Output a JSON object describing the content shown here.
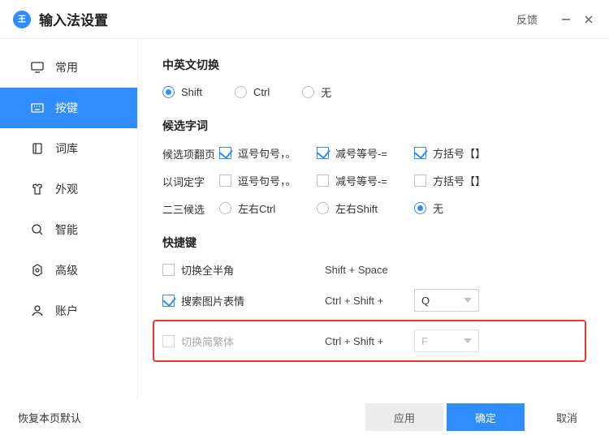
{
  "title": "输入法设置",
  "feedback": "反馈",
  "sidebar": [
    {
      "id": "common",
      "label": "常用"
    },
    {
      "id": "keys",
      "label": "按键"
    },
    {
      "id": "dict",
      "label": "词库"
    },
    {
      "id": "skin",
      "label": "外观"
    },
    {
      "id": "smart",
      "label": "智能"
    },
    {
      "id": "adv",
      "label": "高级"
    },
    {
      "id": "account",
      "label": "账户"
    }
  ],
  "sec1": {
    "heading": "中英文切换",
    "opts": [
      {
        "label": "Shift",
        "checked": true
      },
      {
        "label": "Ctrl",
        "checked": false
      },
      {
        "label": "无",
        "checked": false
      }
    ]
  },
  "sec2": {
    "heading": "候选字词",
    "row1": {
      "label": "候选项翻页",
      "opts": [
        {
          "label": "逗号句号，。",
          "checked": true
        },
        {
          "label": "减号等号-=",
          "checked": true
        },
        {
          "label": "方括号【】",
          "checked": true
        }
      ]
    },
    "row2": {
      "label": "以词定字",
      "opts": [
        {
          "label": "逗号句号，。",
          "checked": false
        },
        {
          "label": "减号等号-=",
          "checked": false
        },
        {
          "label": "方括号【】",
          "checked": false
        }
      ]
    },
    "row3": {
      "label": "二三候选",
      "opts": [
        {
          "label": "左右Ctrl",
          "checked": false
        },
        {
          "label": "左右Shift",
          "checked": false
        },
        {
          "label": "无",
          "checked": true
        }
      ]
    }
  },
  "sec3": {
    "heading": "快捷键",
    "sc1": {
      "label": "切换全半角",
      "checked": false,
      "key": "Shift + Space",
      "sel": null
    },
    "sc2": {
      "label": "搜索图片表情",
      "checked": true,
      "key": "Ctrl + Shift +",
      "sel": "Q"
    },
    "sc3": {
      "label": "切换简繁体",
      "checked": false,
      "key": "Ctrl + Shift +",
      "sel": "F"
    }
  },
  "footer": {
    "restore": "恢复本页默认",
    "apply": "应用",
    "ok": "确定",
    "cancel": "取消"
  }
}
